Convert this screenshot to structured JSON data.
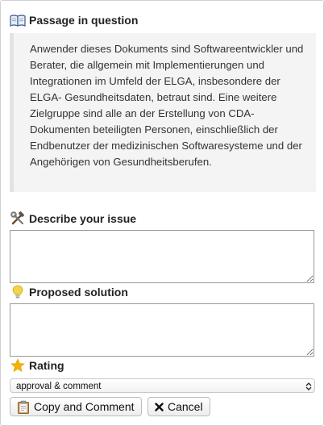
{
  "passage": {
    "title": "Passage in question",
    "icon": "open-book-icon",
    "text": "Anwender dieses Dokuments sind Softwareentwickler und Berater, die allgemein mit Implementierungen und Integrationen im Umfeld der ELGA, insbesondere der ELGA- Gesundheitsdaten, betraut sind. Eine weitere Zielgruppe sind alle an der Erstellung von CDA- Dokumenten beteiligten Personen, einschließlich der Endbenutzer der medizinischen Softwaresysteme und der Angehörigen von Gesundheitsberufen."
  },
  "issue": {
    "title": "Describe your issue",
    "icon": "hammer-and-wrench-icon",
    "value": ""
  },
  "solution": {
    "title": "Proposed solution",
    "icon": "light-bulb-icon",
    "value": ""
  },
  "rating": {
    "title": "Rating",
    "icon": "star-icon",
    "selected": "approval & comment"
  },
  "buttons": {
    "copy_label": "Copy and Comment",
    "cancel_label": "Cancel",
    "copy_icon": "clipboard-icon",
    "cancel_icon": "x-icon"
  },
  "colors": {
    "star": "#f5b301",
    "bulb": "#f3d34a",
    "quote_bg": "#f4f4f4",
    "quote_border": "#e3e3e3"
  }
}
